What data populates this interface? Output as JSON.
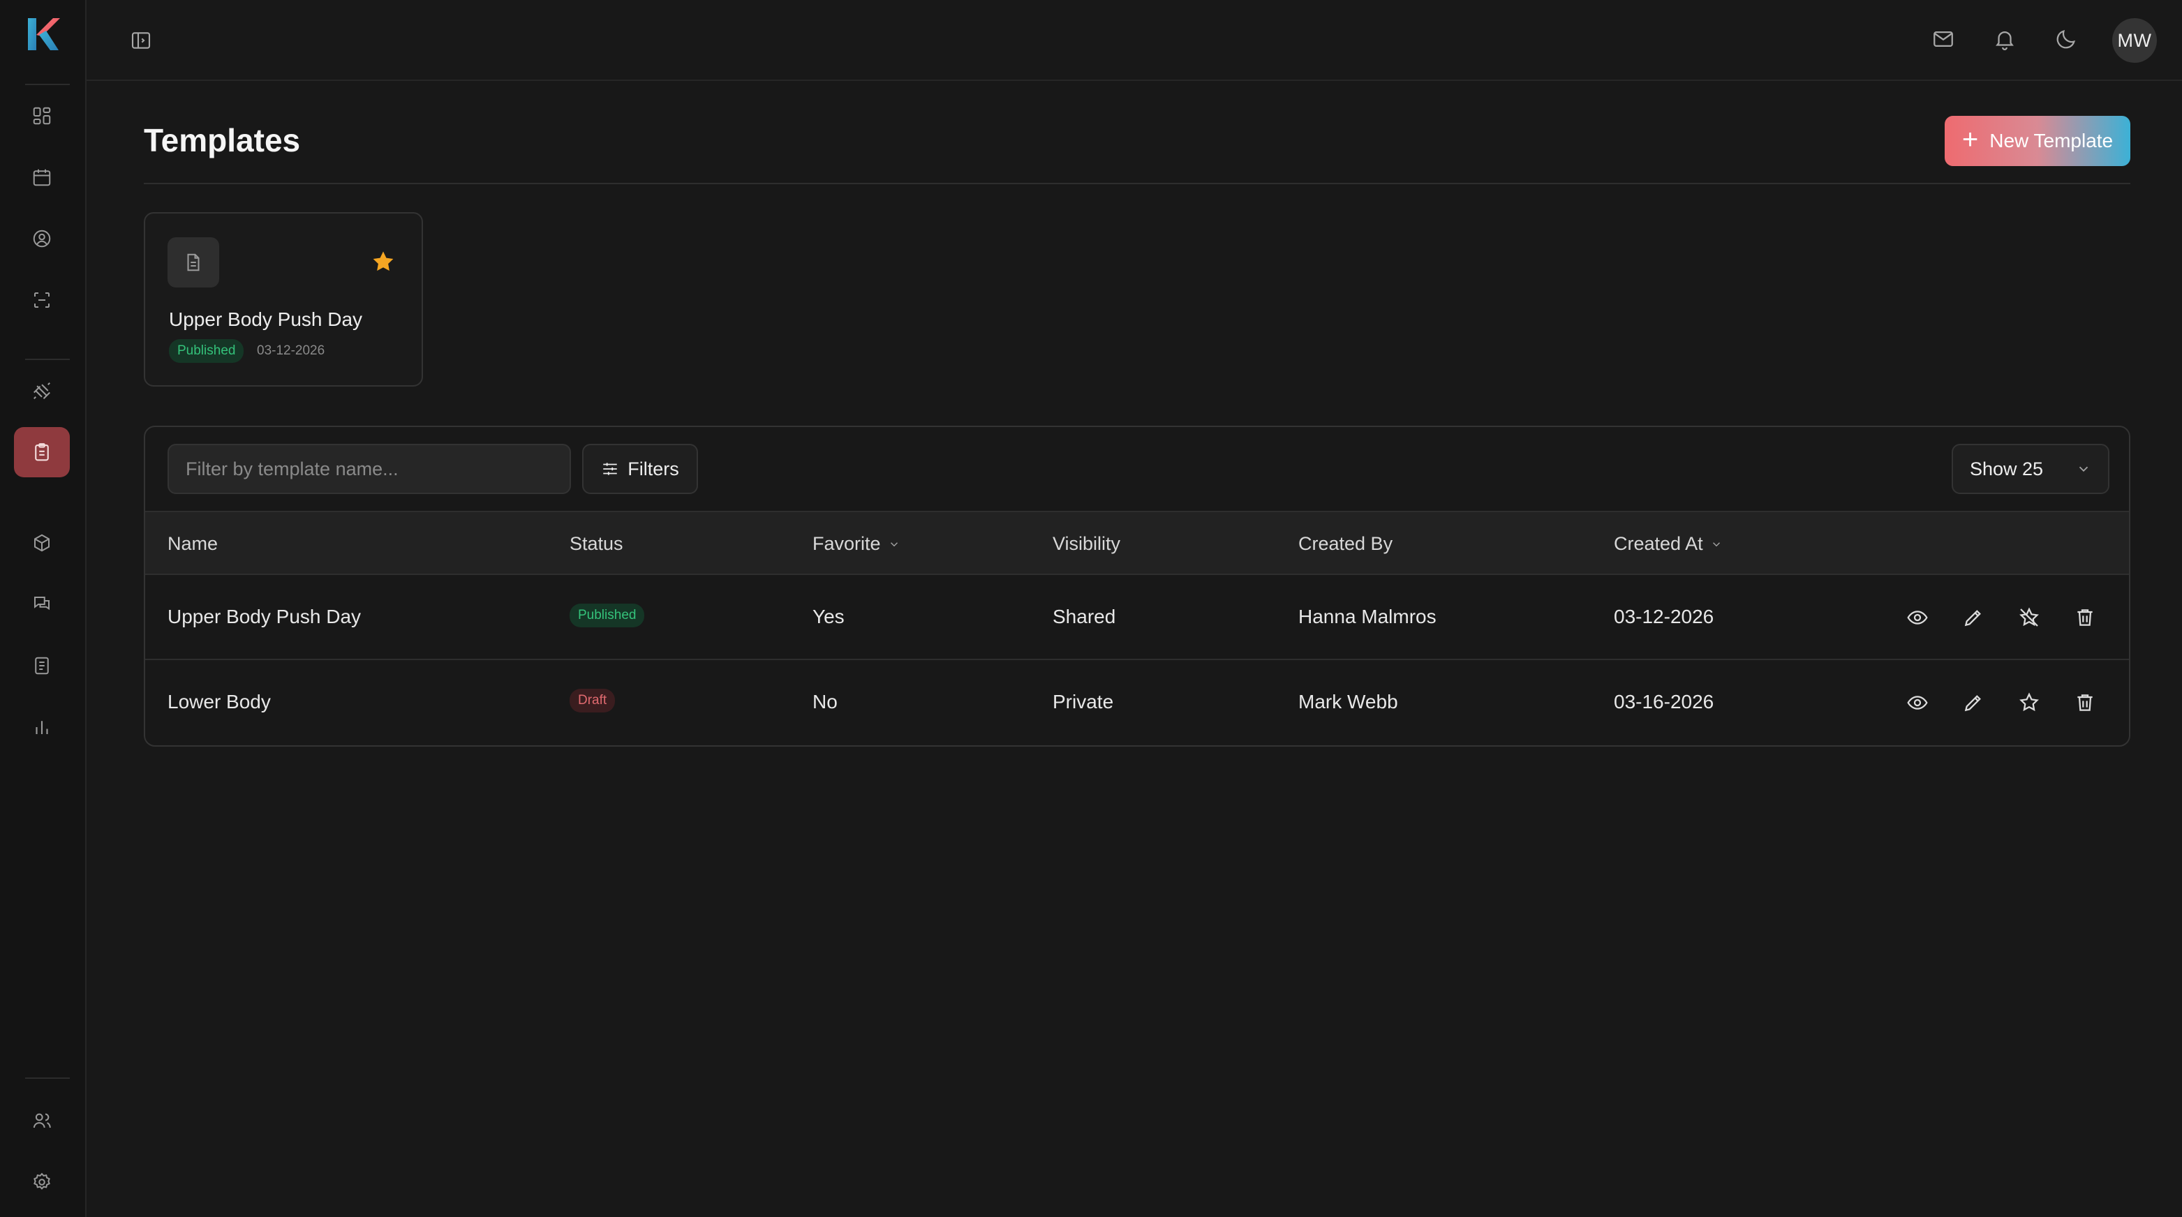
{
  "app": {
    "user_initials": "MW"
  },
  "page": {
    "title": "Templates",
    "new_button_label": "New Template"
  },
  "favorite_card": {
    "name": "Upper Body Push Day",
    "status": "Published",
    "date": "03-12-2026",
    "favorite": true
  },
  "toolbar": {
    "search_placeholder": "Filter by template name...",
    "filters_label": "Filters",
    "page_size_label": "Show 25"
  },
  "table": {
    "columns": [
      "Name",
      "Status",
      "Favorite",
      "Visibility",
      "Created By",
      "Created At"
    ],
    "rows": [
      {
        "name": "Upper Body Push Day",
        "status": "Published",
        "favorite": "Yes",
        "visibility": "Shared",
        "created_by": "Hanna Malmros",
        "created_at": "03-12-2026"
      },
      {
        "name": "Lower Body",
        "status": "Draft",
        "favorite": "No",
        "visibility": "Private",
        "created_by": "Mark Webb",
        "created_at": "03-16-2026"
      }
    ]
  },
  "colors": {
    "background": "#181818",
    "sidebar_active": "#8f3a3e",
    "published": "#34c27a",
    "draft": "#e06a6f",
    "star": "#f5a623",
    "accent_gradient": [
      "#ee6b70",
      "#3cb1d6"
    ]
  },
  "icons": {
    "sidebar": [
      "dashboard-icon",
      "calendar-icon",
      "user-circle-icon",
      "scan-icon",
      "dumbbell-icon",
      "clipboard-icon",
      "package-icon",
      "messages-icon",
      "document-icon",
      "bar-chart-icon",
      "users-icon",
      "settings-icon"
    ],
    "topbar": [
      "sidebar-toggle-icon",
      "mail-icon",
      "bell-icon",
      "moon-icon"
    ],
    "row_actions": [
      "eye-icon",
      "pencil-icon",
      "star-icon",
      "trash-icon"
    ]
  }
}
